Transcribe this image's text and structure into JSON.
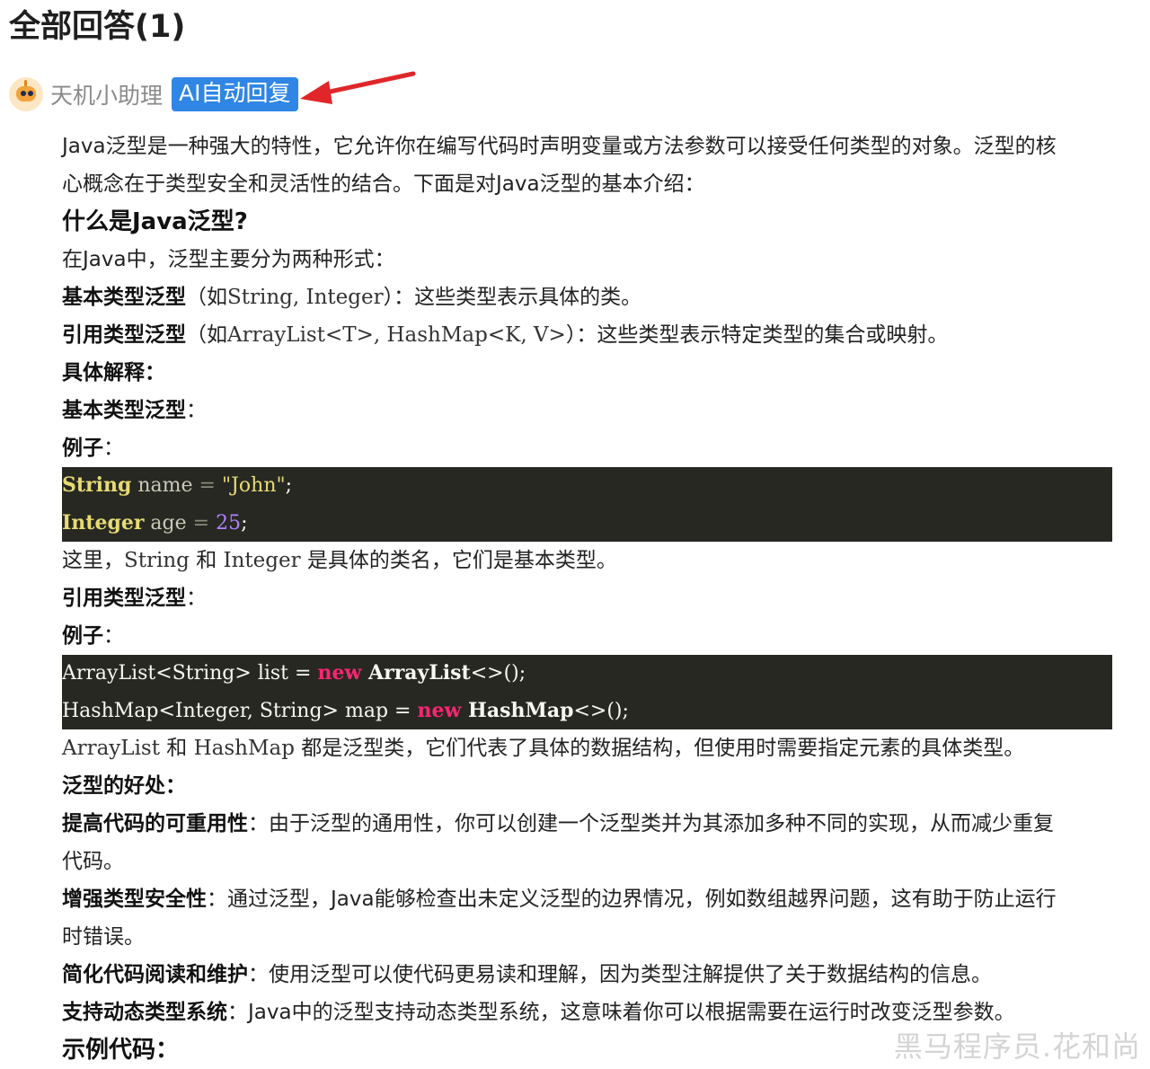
{
  "heading": "全部回答(1)",
  "author": {
    "name": "天机小助理",
    "badge": "AI自动回复"
  },
  "intro": {
    "line1": "Java泛型是一种强大的特性，它允许你在编写代码时声明变量或方法参数可以接受任何类型的对象。泛型的核",
    "line2": "心概念在于类型安全和灵活性的结合。下面是对Java泛型的基本介绍："
  },
  "section1": {
    "title": "什么是Java泛型?",
    "desc": "在Java中，泛型主要分为两种形式：",
    "basic": {
      "label": "基本类型泛型",
      "pre": "（如",
      "code": "String, Integer",
      "post": "）：这些类型表示具体的类。"
    },
    "ref": {
      "label": "引用类型泛型",
      "pre": "（如",
      "code": "ArrayList<T>, HashMap<K, V>",
      "post": "）：这些类型表示特定类型的集合或映射。"
    }
  },
  "explain": {
    "title": "具体解释：",
    "basic_title": "基本类型泛型",
    "example_label": "例子",
    "colon": "：",
    "code1": {
      "l1_type": "String",
      "l1_var": " name ",
      "l1_eq": "= ",
      "l1_val": "\"John\"",
      "l1_end": ";",
      "l2_type": "Integer",
      "l2_var": " age ",
      "l2_eq": "= ",
      "l2_val": "25",
      "l2_end": ";"
    },
    "note1": {
      "pre": "这里，",
      "c1": "String",
      "mid": " 和 ",
      "c2": "Integer",
      "post": " 是具体的类名，它们是基本类型。"
    },
    "ref_title": "引用类型泛型",
    "code2": {
      "l1_a": "ArrayList<String> list = ",
      "l1_new": "new",
      "l1_b": " ArrayList",
      "l1_c": "<>();",
      "l2_a": "HashMap<Integer, String> map = ",
      "l2_new": "new",
      "l2_b": " HashMap",
      "l2_c": "<>();"
    },
    "note2": {
      "c1": "ArrayList",
      "mid": " 和 ",
      "c2": "HashMap",
      "post": " 都是泛型类，它们代表了具体的数据结构，但使用时需要指定元素的具体类型。"
    }
  },
  "benefits": {
    "title": "泛型的好处：",
    "items": [
      {
        "label": "提高代码的可重用性",
        "text": "：由于泛型的通用性，你可以创建一个泛型类并为其添加多种不同的实现，从而减少重复",
        "cont": "代码。"
      },
      {
        "label": "增强类型安全性",
        "text": "：通过泛型，Java能够检查出未定义泛型的边界情况，例如数组越界问题，这有助于防止运行",
        "cont": "时错误。"
      },
      {
        "label": "简化代码阅读和维护",
        "text": "：使用泛型可以使代码更易读和理解，因为类型注解提供了关于数据结构的信息。"
      },
      {
        "label": "支持动态类型系统",
        "text": "：Java中的泛型支持动态类型系统，这意味着你可以根据需要在运行时改变泛型参数。"
      }
    ]
  },
  "example_code_title": "示例代码：",
  "watermark": "黑马程序员.花和尚",
  "colors": {
    "badge": "#2f86e5",
    "code_bg": "#272822",
    "arrow": "#e0262a"
  }
}
